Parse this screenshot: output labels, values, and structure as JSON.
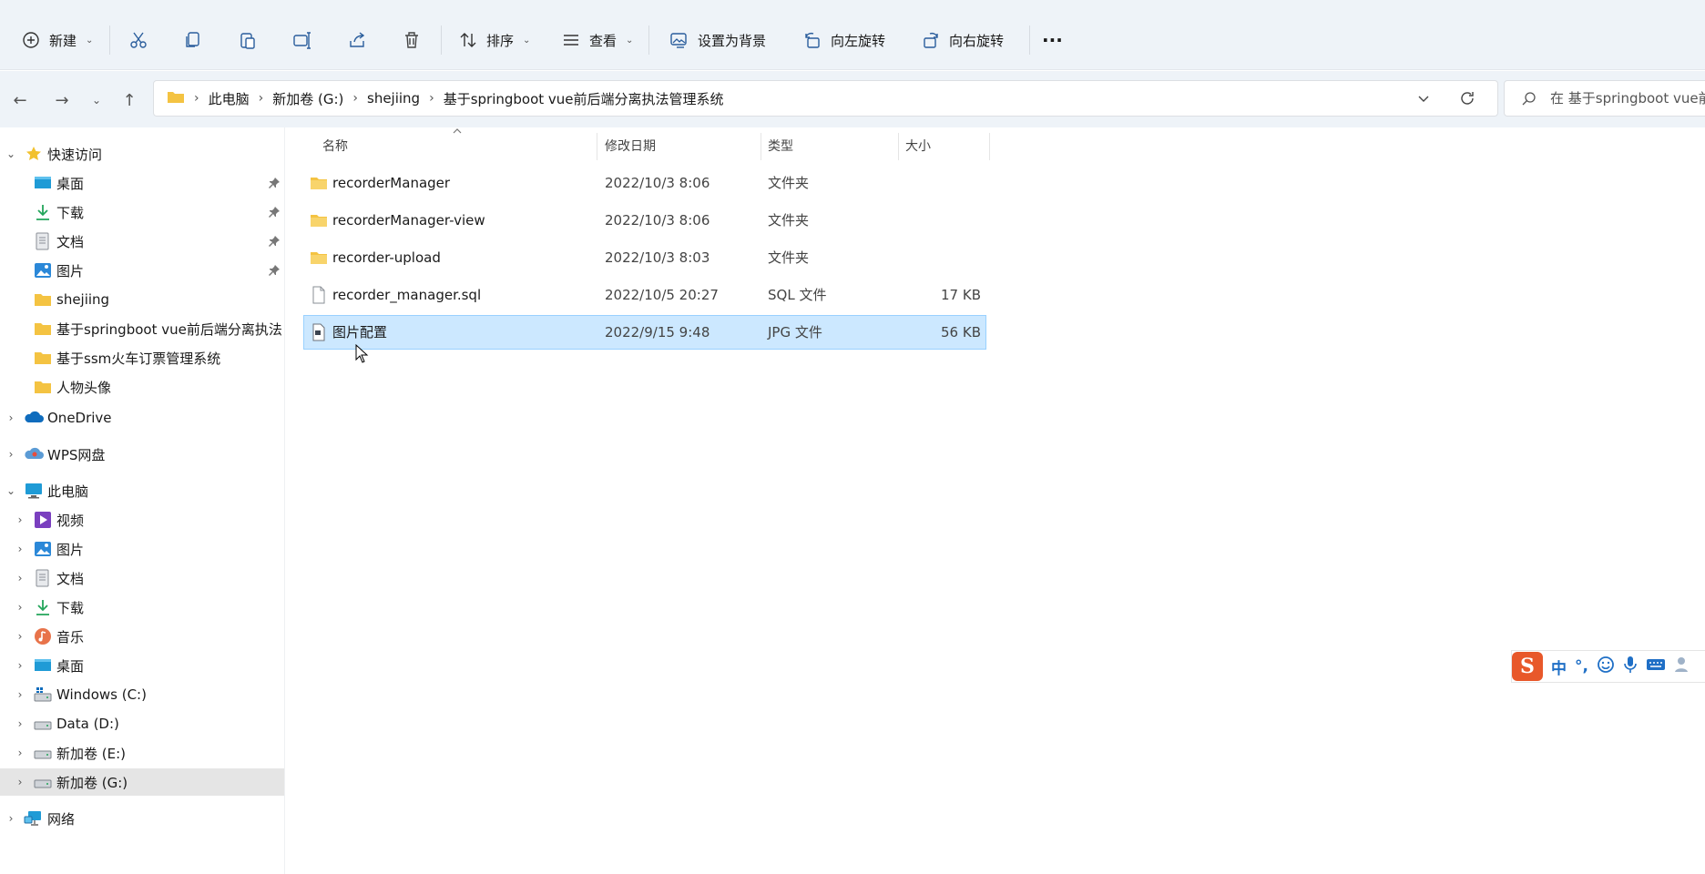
{
  "toolbar": {
    "new_label": "新建",
    "sort_label": "排序",
    "view_label": "查看",
    "set_bg_label": "设置为背景",
    "rotate_left_label": "向左旋转",
    "rotate_right_label": "向右旋转",
    "more_label": "···"
  },
  "address": {
    "crumbs": [
      "此电脑",
      "新加卷 (G:)",
      "shejiing",
      "基于springboot vue前后端分离执法管理系统"
    ],
    "search_placeholder": "在 基于springboot vue前"
  },
  "sidebar": {
    "quick_access": "快速访问",
    "quick_items": [
      "桌面",
      "下载",
      "文档",
      "图片",
      "shejiing",
      "基于springboot vue前后端分离执法",
      "基于ssm火车订票管理系统",
      "人物头像"
    ],
    "onedrive": "OneDrive",
    "wps": "WPS网盘",
    "this_pc": "此电脑",
    "pc_items": [
      "视频",
      "图片",
      "文档",
      "下载",
      "音乐",
      "桌面",
      "Windows (C:)",
      "Data (D:)",
      "新加卷 (E:)",
      "新加卷 (G:)"
    ],
    "network": "网络"
  },
  "columns": {
    "name": "名称",
    "date": "修改日期",
    "type": "类型",
    "size": "大小"
  },
  "files": [
    {
      "name": "recorderManager",
      "date": "2022/10/3 8:06",
      "type": "文件夹",
      "size": ""
    },
    {
      "name": "recorderManager-view",
      "date": "2022/10/3 8:06",
      "type": "文件夹",
      "size": ""
    },
    {
      "name": "recorder-upload",
      "date": "2022/10/3 8:03",
      "type": "文件夹",
      "size": ""
    },
    {
      "name": "recorder_manager.sql",
      "date": "2022/10/5 20:27",
      "type": "SQL 文件",
      "size": "17 KB"
    },
    {
      "name": "图片配置",
      "date": "2022/9/15 9:48",
      "type": "JPG 文件",
      "size": "56 KB"
    }
  ],
  "ime": {
    "logo": "S",
    "mode": "中",
    "punct": "°,"
  },
  "colors": {
    "toolbar_bg": "#eef3f8",
    "selected_row": "#cce8ff",
    "folder": "#f4c342",
    "accent": "#1f6fc6"
  }
}
